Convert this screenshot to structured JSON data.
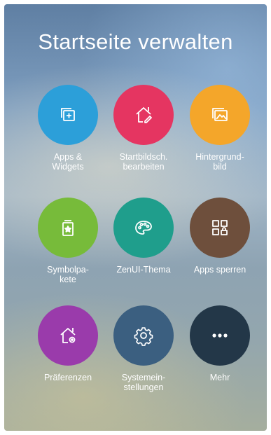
{
  "header": {
    "title": "Startseite verwalten"
  },
  "tiles": [
    {
      "label": "Apps &\nWidgets",
      "icon": "apps-widgets-icon",
      "color": "#2c9fd9"
    },
    {
      "label": "Startbildsch.\nbearbeiten",
      "icon": "home-edit-icon",
      "color": "#e53561"
    },
    {
      "label": "Hintergrund-\nbild",
      "icon": "wallpaper-icon",
      "color": "#f4a62a"
    },
    {
      "label": "Symbolpa-\nkete",
      "icon": "icon-pack-icon",
      "color": "#77bb3a"
    },
    {
      "label": "ZenUI-Thema",
      "icon": "palette-icon",
      "color": "#1f9e8c"
    },
    {
      "label": "Apps sperren",
      "icon": "app-lock-icon",
      "color": "#6e4f3c"
    },
    {
      "label": "Präferenzen",
      "icon": "home-settings-icon",
      "color": "#9a3bab"
    },
    {
      "label": "Systemein-\nstellungen",
      "icon": "gear-icon",
      "color": "#3b5f80"
    },
    {
      "label": "Mehr",
      "icon": "more-icon",
      "color": "#233748"
    }
  ]
}
